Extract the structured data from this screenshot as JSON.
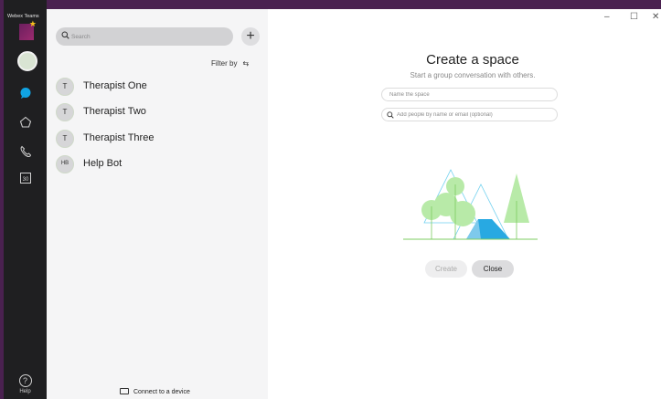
{
  "app": {
    "title": "Webex Teams"
  },
  "rail": {
    "help_label": "Help",
    "nav_icons": [
      "chat-icon",
      "teams-icon",
      "phone-icon",
      "calendar-icon"
    ],
    "calendar_day": "30"
  },
  "list": {
    "search_placeholder": "Search",
    "add_label": "+",
    "filter_label": "Filter by",
    "contacts": [
      {
        "initials": "T",
        "name": "Therapist One"
      },
      {
        "initials": "T",
        "name": "Therapist Two"
      },
      {
        "initials": "T",
        "name": "Therapist Three"
      },
      {
        "initials": "HB",
        "name": "Help Bot"
      }
    ],
    "connect_label": "Connect to a device"
  },
  "window": {
    "minimize": "–",
    "maximize": "☐",
    "close": "✕"
  },
  "main": {
    "title": "Create a space",
    "subtitle": "Start a group conversation with others.",
    "name_placeholder": "Name the space",
    "people_placeholder": "Add people by name or email (optional)",
    "create_label": "Create",
    "close_label": "Close"
  },
  "colors": {
    "brand_purple": "#4a2150",
    "rail_bg": "#1f1f21",
    "accent_blue": "#10a4e4",
    "illustration_green": "#8fdc73",
    "tent_blue": "#28a9e2"
  }
}
